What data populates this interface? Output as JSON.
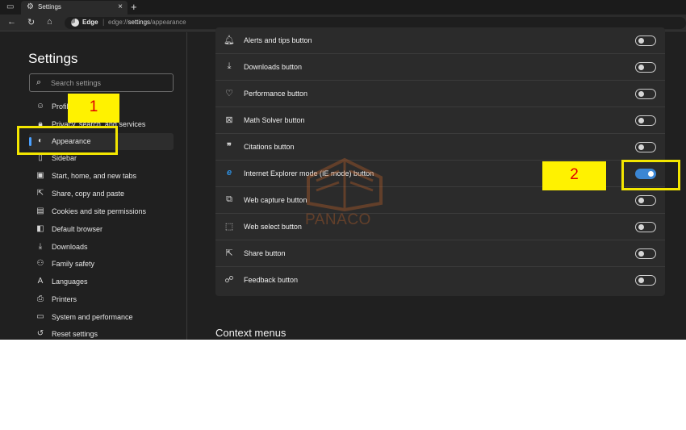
{
  "browser": {
    "tab_title": "Settings",
    "tab_close": "×",
    "new_tab": "+",
    "edge_label": "Edge",
    "url_prefix": "edge://",
    "url_bold": "settings",
    "url_suffix": "/appearance",
    "url_separator": "|"
  },
  "sidebar": {
    "title": "Settings",
    "search_placeholder": "Search settings",
    "items": [
      {
        "label": "Profiles",
        "icon": "profile-icon"
      },
      {
        "label": "Privacy, search, and services",
        "icon": "lock-icon"
      },
      {
        "label": "Appearance",
        "icon": "appearance-icon",
        "selected": true
      },
      {
        "label": "Sidebar",
        "icon": "sidebar-icon"
      },
      {
        "label": "Start, home, and new tabs",
        "icon": "start-tabs-icon"
      },
      {
        "label": "Share, copy and paste",
        "icon": "share-icon"
      },
      {
        "label": "Cookies and site permissions",
        "icon": "cookies-icon"
      },
      {
        "label": "Default browser",
        "icon": "default-browser-icon"
      },
      {
        "label": "Downloads",
        "icon": "download-icon"
      },
      {
        "label": "Family safety",
        "icon": "family-icon"
      },
      {
        "label": "Languages",
        "icon": "languages-icon"
      },
      {
        "label": "Printers",
        "icon": "printer-icon"
      },
      {
        "label": "System and performance",
        "icon": "system-icon"
      },
      {
        "label": "Reset settings",
        "icon": "reset-icon"
      }
    ]
  },
  "toolbar_buttons": [
    {
      "label": "Alerts and tips button",
      "icon": "bell-icon",
      "on": false
    },
    {
      "label": "Downloads button",
      "icon": "download-icon",
      "on": false
    },
    {
      "label": "Performance button",
      "icon": "heart-pulse-icon",
      "on": false
    },
    {
      "label": "Math Solver button",
      "icon": "math-solver-icon",
      "on": false
    },
    {
      "label": "Citations button",
      "icon": "quote-icon",
      "on": false
    },
    {
      "label": "Internet Explorer mode (IE mode) button",
      "icon": "ie-icon",
      "on": true
    },
    {
      "label": "Web capture button",
      "icon": "web-capture-icon",
      "on": false
    },
    {
      "label": "Web select button",
      "icon": "web-select-icon",
      "on": false
    },
    {
      "label": "Share button",
      "icon": "share-icon",
      "on": false
    },
    {
      "label": "Feedback button",
      "icon": "feedback-icon",
      "on": false
    }
  ],
  "context_menus_heading": "Context menus",
  "annotations": {
    "callout_1": "1",
    "callout_2": "2"
  },
  "watermark": {
    "text": "PANACO"
  },
  "colors": {
    "accent": "#3b86d4",
    "callout_bg": "#fff200",
    "callout_text": "#e00000",
    "watermark": "#c8642a"
  }
}
